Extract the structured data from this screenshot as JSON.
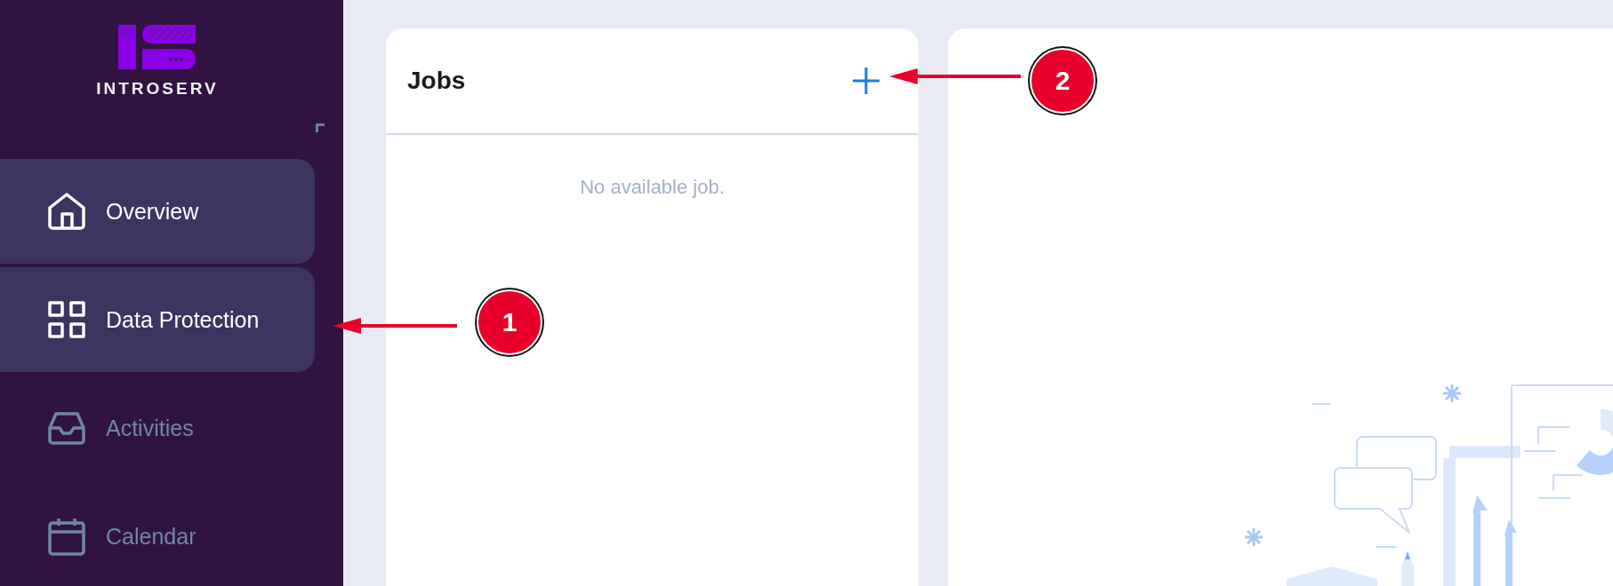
{
  "logo": {
    "text": "INTROSERV"
  },
  "sidebar": {
    "items": [
      {
        "label": "Overview",
        "selected": true
      },
      {
        "label": "Data Protection",
        "selected": true
      },
      {
        "label": "Activities",
        "selected": false
      },
      {
        "label": "Calendar",
        "selected": false
      }
    ]
  },
  "jobs_panel": {
    "title": "Jobs",
    "empty_text": "No available job."
  },
  "annotations": [
    {
      "label": "1"
    },
    {
      "label": "2"
    }
  ]
}
